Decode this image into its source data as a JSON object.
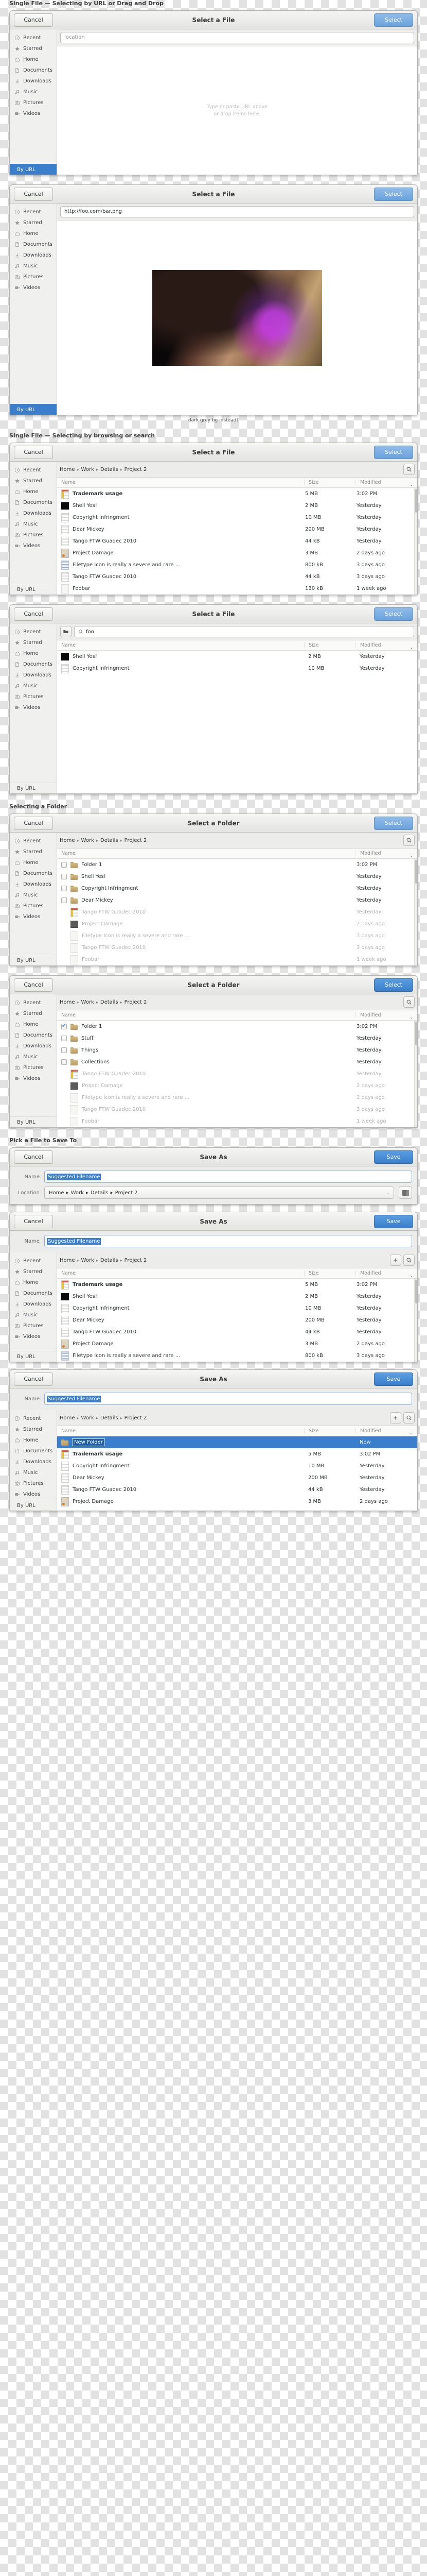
{
  "sections": {
    "s1": "Single File — Selecting by URL or Drag and Drop",
    "s2": "Single File — Selecting by browsing or search",
    "s3": "Selecting a Folder",
    "s4": "Pick a File to Save To"
  },
  "buttons": {
    "cancel": "Cancel",
    "select": "Select",
    "save": "Save"
  },
  "titles": {
    "select_file": "Select a File",
    "select_folder": "Select a Folder",
    "save_as": "Save As"
  },
  "sidebar": {
    "items": [
      {
        "label": "Recent",
        "icon": "clock-icon"
      },
      {
        "label": "Starred",
        "icon": "star-icon"
      },
      {
        "label": "Home",
        "icon": "home-icon"
      },
      {
        "label": "Documents",
        "icon": "document-icon"
      },
      {
        "label": "Downloads",
        "icon": "download-icon"
      },
      {
        "label": "Music",
        "icon": "music-icon"
      },
      {
        "label": "Pictures",
        "icon": "camera-icon"
      },
      {
        "label": "Videos",
        "icon": "video-icon"
      }
    ],
    "by_url": "By URL"
  },
  "location": {
    "placeholder": "location",
    "url_value": "http://foo.com/bar.png"
  },
  "dropzone": {
    "line1": "Type or paste URL above",
    "line2": "or drop items here."
  },
  "caption": "dark grey bg instead?",
  "breadcrumb": [
    "Home",
    "Work",
    "Details",
    "Project 2"
  ],
  "search": {
    "query": "foo",
    "placeholder": "Search"
  },
  "columns": {
    "name": "Name",
    "size": "Size",
    "modified": "Modified"
  },
  "save_form": {
    "name_label": "Name",
    "location_label": "Location",
    "suggested_name": "Suggested Filename",
    "new_folder_name": "New Folder"
  },
  "files_browse": [
    {
      "name": "Trademark usage",
      "size": "5 MB",
      "modified": "3:02 PM",
      "icon": "doc-top",
      "bold": true
    },
    {
      "name": "Shell Yes!",
      "size": "2 MB",
      "modified": "Yesterday",
      "icon": "black"
    },
    {
      "name": "Copyright Infringment",
      "size": "10 MB",
      "modified": "Yesterday",
      "icon": "doc"
    },
    {
      "name": "Dear Mickey",
      "size": "200 MB",
      "modified": "Yesterday",
      "icon": "doc"
    },
    {
      "name": "Tango FTW Guadec 2010",
      "size": "44 kB",
      "modified": "Yesterday",
      "icon": "doc"
    },
    {
      "name": "Project Damage",
      "size": "3 MB",
      "modified": "2 days ago",
      "icon": "mix"
    },
    {
      "name": "Filetype Icon is really a severe and rare ...",
      "size": "800 kB",
      "modified": "3 days ago",
      "icon": "blue"
    },
    {
      "name": "Tango FTW Guadec 2010",
      "size": "44 kB",
      "modified": "3 days ago",
      "icon": "doc"
    },
    {
      "name": "Foobar",
      "size": "130 kB",
      "modified": "1 week ago",
      "icon": "pale"
    }
  ],
  "files_search": [
    {
      "name": "Shell Yes!",
      "size": "2 MB",
      "modified": "Yesterday",
      "icon": "black"
    },
    {
      "name": "Copyright Infringment",
      "size": "10 MB",
      "modified": "Yesterday",
      "icon": "doc"
    }
  ],
  "folders_a": [
    {
      "name": "Folder 1",
      "modified": "3:02 PM",
      "kind": "folder",
      "checked": false
    },
    {
      "name": "Shell Yes!",
      "modified": "Yesterday",
      "kind": "folder",
      "checked": false
    },
    {
      "name": "Copyright Infringment",
      "modified": "Yesterday",
      "kind": "folder",
      "checked": false
    },
    {
      "name": "Dear Mickey",
      "modified": "Yesterday",
      "kind": "folder",
      "checked": false
    },
    {
      "name": "Tango FTW Guadec 2010",
      "modified": "Yesterday",
      "kind": "file",
      "icon": "doc-top"
    },
    {
      "name": "Project Damage",
      "modified": "2 days ago",
      "kind": "file",
      "icon": "dark"
    },
    {
      "name": "Filetype Icon is really a severe and rare ...",
      "modified": "3 days ago",
      "kind": "file",
      "icon": "pale"
    },
    {
      "name": "Tango FTW Guadec 2010",
      "modified": "3 days ago",
      "kind": "file",
      "icon": "pale"
    },
    {
      "name": "Foobar",
      "modified": "1 week ago",
      "kind": "file",
      "icon": "pale"
    }
  ],
  "folders_b": [
    {
      "name": "Folder 1",
      "modified": "3:02 PM",
      "kind": "folder",
      "checked": true
    },
    {
      "name": "Stuff",
      "modified": "Yesterday",
      "kind": "folder",
      "checked": false
    },
    {
      "name": "Things",
      "modified": "Yesterday",
      "kind": "folder",
      "checked": false
    },
    {
      "name": "Collections",
      "modified": "Yesterday",
      "kind": "folder",
      "checked": false
    },
    {
      "name": "Tango FTW Guadec 2010",
      "modified": "Yesterday",
      "kind": "file",
      "icon": "doc-top"
    },
    {
      "name": "Project Damage",
      "modified": "2 days ago",
      "kind": "file",
      "icon": "dark"
    },
    {
      "name": "Filetype Icon is really a severe and rare ...",
      "modified": "3 days ago",
      "kind": "file",
      "icon": "pale"
    },
    {
      "name": "Tango FTW Guadec 2010",
      "modified": "3 days ago",
      "kind": "file",
      "icon": "pale"
    },
    {
      "name": "Foobar",
      "modified": "1 week ago",
      "kind": "file",
      "icon": "pale"
    }
  ],
  "files_saveas": [
    {
      "name": "Trademark usage",
      "size": "5 MB",
      "modified": "3:02 PM",
      "icon": "doc-top",
      "bold": true
    },
    {
      "name": "Shell Yes!",
      "size": "2 MB",
      "modified": "Yesterday",
      "icon": "black"
    },
    {
      "name": "Copyright Infringment",
      "size": "10 MB",
      "modified": "Yesterday",
      "icon": "doc"
    },
    {
      "name": "Dear Mickey",
      "size": "200 MB",
      "modified": "Yesterday",
      "icon": "doc"
    },
    {
      "name": "Tango FTW Guadec 2010",
      "size": "44 kB",
      "modified": "Yesterday",
      "icon": "doc"
    },
    {
      "name": "Project Damage",
      "size": "3 MB",
      "modified": "2 days ago",
      "icon": "mix"
    },
    {
      "name": "Filetype Icon is really a severe and rare ...",
      "size": "800 kB",
      "modified": "3 days ago",
      "icon": "blue"
    }
  ],
  "files_newfolder": [
    {
      "name": "Trademark usage",
      "size": "5 MB",
      "modified": "3:02 PM",
      "icon": "doc-top",
      "bold": true
    },
    {
      "name": "Copyright Infringment",
      "size": "10 MB",
      "modified": "Yesterday",
      "icon": "doc"
    },
    {
      "name": "Dear Mickey",
      "size": "200 MB",
      "modified": "Yesterday",
      "icon": "doc"
    },
    {
      "name": "Tango FTW Guadec 2010",
      "size": "44 kB",
      "modified": "Yesterday",
      "icon": "doc"
    },
    {
      "name": "Project Damage",
      "size": "3 MB",
      "modified": "2 days ago",
      "icon": "mix"
    }
  ],
  "newfolder_row": {
    "name": "New Folder",
    "modified": "Now"
  },
  "colors": {
    "accent": "#3b7fcc",
    "accent_light": "#6ba3dd",
    "sidebar_bg": "#f0f0ee"
  }
}
